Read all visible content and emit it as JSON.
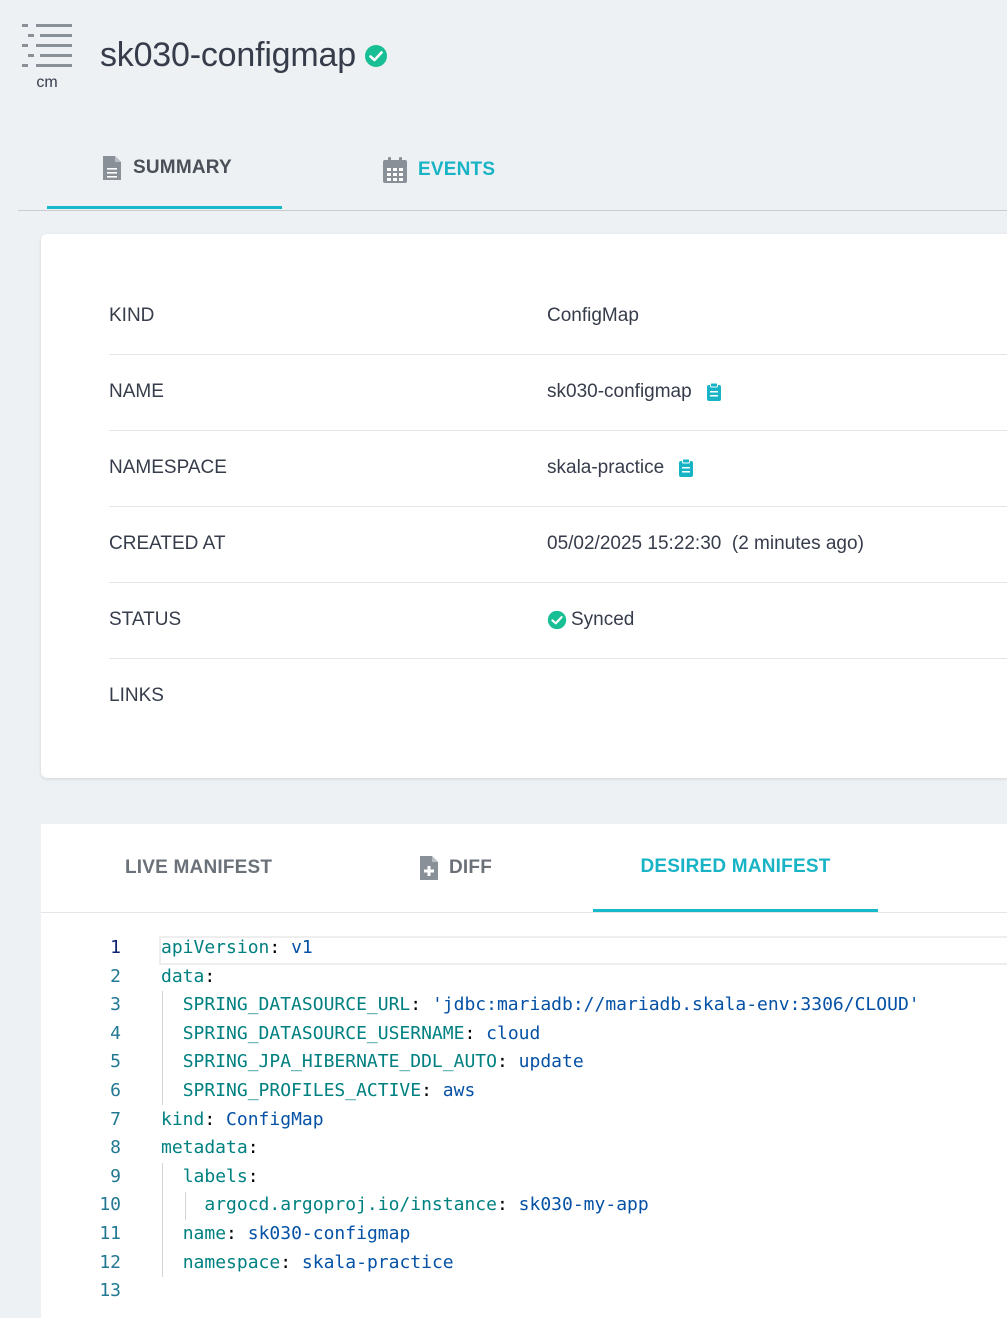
{
  "header": {
    "kind_abbr": "cm",
    "title": "sk030-configmap",
    "status_icon": "check-circle-icon",
    "colors": {
      "accent": "#18b4c6",
      "success": "#18be94"
    }
  },
  "tabs": [
    {
      "label": "SUMMARY",
      "icon": "document-icon",
      "active": true
    },
    {
      "label": "EVENTS",
      "icon": "calendar-icon",
      "active": false
    }
  ],
  "summary": {
    "rows": [
      {
        "label": "KIND",
        "value": "ConfigMap"
      },
      {
        "label": "NAME",
        "value": "sk030-configmap"
      },
      {
        "label": "NAMESPACE",
        "value": "skala-practice"
      },
      {
        "label": "CREATED AT",
        "value": "05/02/2025 15:22:30  (2 minutes ago)"
      },
      {
        "label": "STATUS",
        "value": "Synced"
      },
      {
        "label": "LINKS",
        "value": ""
      }
    ]
  },
  "manifest": {
    "tabs": [
      {
        "label": "LIVE MANIFEST",
        "active": false
      },
      {
        "label": "DIFF",
        "icon": "diff-file-icon",
        "active": false
      },
      {
        "label": "DESIRED MANIFEST",
        "active": true
      }
    ],
    "lines": [
      {
        "num": "1",
        "key": "apiVersion",
        "val": "v1"
      },
      {
        "num": "2",
        "key": "data",
        "val": ""
      },
      {
        "num": "3",
        "key": "SPRING_DATASOURCE_URL",
        "val": "'jdbc:mariadb://mariadb.skala-env:3306/CLOUD'"
      },
      {
        "num": "4",
        "key": "SPRING_DATASOURCE_USERNAME",
        "val": "cloud"
      },
      {
        "num": "5",
        "key": "SPRING_JPA_HIBERNATE_DDL_AUTO",
        "val": "update"
      },
      {
        "num": "6",
        "key": "SPRING_PROFILES_ACTIVE",
        "val": "aws"
      },
      {
        "num": "7",
        "key": "kind",
        "val": "ConfigMap"
      },
      {
        "num": "8",
        "key": "metadata",
        "val": ""
      },
      {
        "num": "9",
        "key": "labels",
        "val": ""
      },
      {
        "num": "10",
        "key": "argocd.argoproj.io/instance",
        "val": "sk030-my-app"
      },
      {
        "num": "11",
        "key": "name",
        "val": "sk030-configmap"
      },
      {
        "num": "12",
        "key": "namespace",
        "val": "skala-practice"
      },
      {
        "num": "13",
        "key": "",
        "val": ""
      }
    ]
  }
}
